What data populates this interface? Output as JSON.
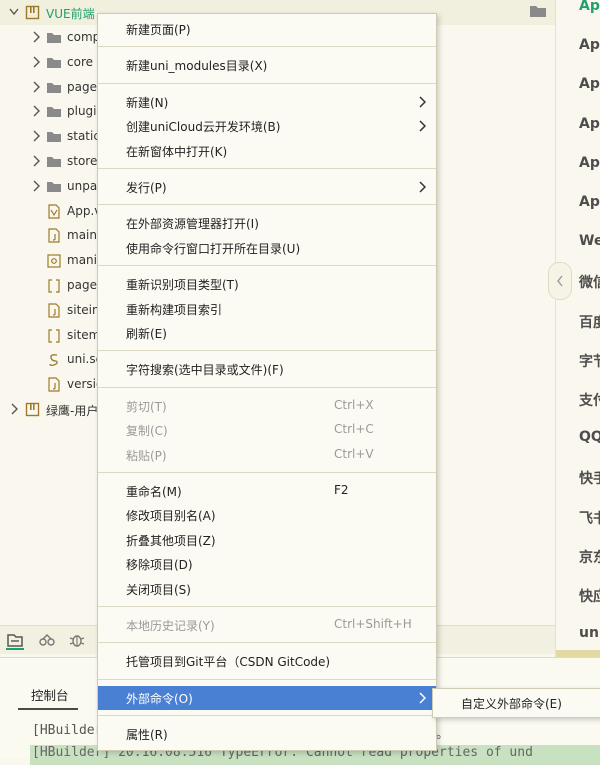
{
  "tree": {
    "root_label": "VUE前端",
    "items": [
      {
        "label": "comp",
        "kind": "folder"
      },
      {
        "label": "core",
        "kind": "folder"
      },
      {
        "label": "page",
        "kind": "folder"
      },
      {
        "label": "plugi",
        "kind": "folder"
      },
      {
        "label": "static",
        "kind": "folder"
      },
      {
        "label": "store",
        "kind": "folder"
      },
      {
        "label": "unpa",
        "kind": "folder"
      },
      {
        "label": "App.v",
        "kind": "vue-file"
      },
      {
        "label": "main",
        "kind": "js-file"
      },
      {
        "label": "mani",
        "kind": "json-file"
      },
      {
        "label": "page",
        "kind": "bracket-file"
      },
      {
        "label": "sitein",
        "kind": "js-file"
      },
      {
        "label": "sitem",
        "kind": "bracket-file"
      },
      {
        "label": "uni.sc",
        "kind": "scss-file"
      },
      {
        "label": "versio",
        "kind": "js-file"
      }
    ],
    "second_root_label": "绿鹰-用户"
  },
  "right_panel": {
    "items": [
      "Ap",
      "Ap",
      "Ap",
      "Ap",
      "Ap",
      "Ap",
      "We",
      "微信",
      "百度",
      "字节",
      "支付",
      "QQ",
      "快手",
      "飞书",
      "京东",
      "快应",
      "uni"
    ]
  },
  "console": {
    "tab_label": "控制台",
    "line1": "[HBuilder",
    "line1_tail": "。",
    "line2": "[HBuilder] 20:16:08.516 TypeError: Cannot read properties of und"
  },
  "context_menu": {
    "groups": [
      [
        {
          "label": "新建页面(P)"
        }
      ],
      [
        {
          "label": "新建uni_modules目录(X)"
        }
      ],
      [
        {
          "label": "新建(N)",
          "submenu": true
        },
        {
          "label": "创建uniCloud云开发环境(B)",
          "submenu": true
        },
        {
          "label": "在新窗体中打开(K)"
        }
      ],
      [
        {
          "label": "发行(P)",
          "submenu": true
        }
      ],
      [
        {
          "label": "在外部资源管理器打开(I)"
        },
        {
          "label": "使用命令行窗口打开所在目录(U)"
        }
      ],
      [
        {
          "label": "重新识别项目类型(T)"
        },
        {
          "label": "重新构建项目索引"
        },
        {
          "label": "刷新(E)"
        }
      ],
      [
        {
          "label": "字符搜索(选中目录或文件)(F)"
        }
      ],
      [
        {
          "label": "剪切(T)",
          "shortcut": "Ctrl+X",
          "disabled": true
        },
        {
          "label": "复制(C)",
          "shortcut": "Ctrl+C",
          "disabled": true
        },
        {
          "label": "粘贴(P)",
          "shortcut": "Ctrl+V",
          "disabled": true
        }
      ],
      [
        {
          "label": "重命名(M)",
          "shortcut": "F2"
        },
        {
          "label": "修改项目别名(A)"
        },
        {
          "label": "折叠其他项目(Z)"
        },
        {
          "label": "移除项目(D)"
        },
        {
          "label": "关闭项目(S)"
        }
      ],
      [
        {
          "label": "本地历史记录(Y)",
          "shortcut": "Ctrl+Shift+H",
          "disabled": true
        }
      ],
      [
        {
          "label": "托管项目到Git平台（CSDN GitCode)"
        }
      ],
      [
        {
          "label": "外部命令(O)",
          "submenu": true,
          "highlight": true
        }
      ],
      [
        {
          "label": "属性(R)"
        }
      ]
    ]
  },
  "submenu": {
    "label": "自定义外部命令(E)"
  },
  "colors": {
    "accent_green": "#22a06b",
    "menu_highlight": "#4a80d4",
    "console_highlight": "#c8e1c0"
  }
}
